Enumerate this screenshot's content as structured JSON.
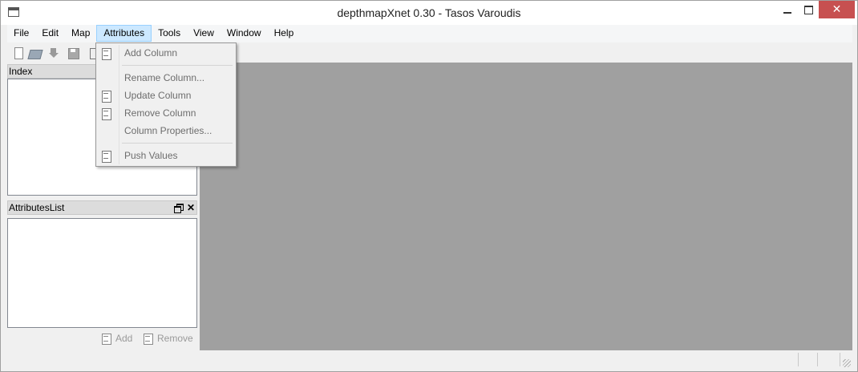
{
  "window": {
    "title": "depthmapXnet 0.30 - Tasos Varoudis",
    "close_glyph": "✕"
  },
  "menubar": {
    "items": [
      {
        "label": "File"
      },
      {
        "label": "Edit"
      },
      {
        "label": "Map"
      },
      {
        "label": "Attributes"
      },
      {
        "label": "Tools"
      },
      {
        "label": "View"
      },
      {
        "label": "Window"
      },
      {
        "label": "Help"
      }
    ]
  },
  "attributes_menu": {
    "add_column": "Add Column",
    "rename_column": "Rename Column...",
    "update_column": "Update Column",
    "remove_column": "Remove Column",
    "column_properties": "Column Properties...",
    "push_values": "Push Values"
  },
  "index_panel": {
    "title": "Index"
  },
  "attributes_panel": {
    "title": "AttributesList",
    "close_glyph": "✕",
    "add_label": "Add",
    "remove_label": "Remove"
  },
  "colors": {
    "workspace": "#a0a0a0",
    "close_button": "#c75050",
    "menu_active": "#cce8ff",
    "disabled_text": "#6d6d6d"
  }
}
